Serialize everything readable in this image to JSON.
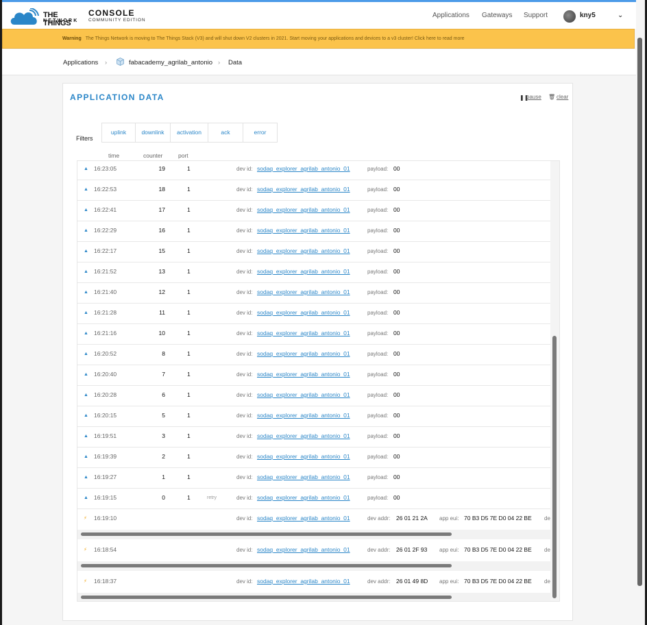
{
  "header": {
    "brand_line1": "THE THINGS",
    "brand_line2": "NETWORK",
    "console_title": "CONSOLE",
    "console_subtitle": "COMMUNITY EDITION",
    "nav": [
      "Applications",
      "Gateways",
      "Support"
    ],
    "username": "kny5"
  },
  "warning": {
    "label": "Warning",
    "text": "The Things Network is moving to The Things Stack (V3) and will shut down V2 clusters in 2021. Start moving your applications and devices to a v3 cluster! Click here to read more"
  },
  "breadcrumb": {
    "root": "Applications",
    "app": "fabacademy_agrilab_antonio",
    "current": "Data"
  },
  "card": {
    "title": "APPLICATION DATA",
    "pause_label": "pause",
    "clear_label": "clear",
    "filters_label": "Filters",
    "filters": [
      "uplink",
      "downlink",
      "activation",
      "ack",
      "error"
    ],
    "columns": {
      "time": "time",
      "counter": "counter",
      "port": "port"
    }
  },
  "labels": {
    "dev_id": "dev id:",
    "payload": "payload:",
    "dev_addr": "dev addr:",
    "app_eui": "app eui:",
    "retry": "retry",
    "truncated": "de"
  },
  "uplinks": [
    {
      "time": "16:23:05",
      "counter": "19",
      "port": "1",
      "dev_id": "sodaq_explorer_agrilab_antonio_01",
      "payload": "00"
    },
    {
      "time": "16:22:53",
      "counter": "18",
      "port": "1",
      "dev_id": "sodaq_explorer_agrilab_antonio_01",
      "payload": "00"
    },
    {
      "time": "16:22:41",
      "counter": "17",
      "port": "1",
      "dev_id": "sodaq_explorer_agrilab_antonio_01",
      "payload": "00"
    },
    {
      "time": "16:22:29",
      "counter": "16",
      "port": "1",
      "dev_id": "sodaq_explorer_agrilab_antonio_01",
      "payload": "00"
    },
    {
      "time": "16:22:17",
      "counter": "15",
      "port": "1",
      "dev_id": "sodaq_explorer_agrilab_antonio_01",
      "payload": "00"
    },
    {
      "time": "16:21:52",
      "counter": "13",
      "port": "1",
      "dev_id": "sodaq_explorer_agrilab_antonio_01",
      "payload": "00"
    },
    {
      "time": "16:21:40",
      "counter": "12",
      "port": "1",
      "dev_id": "sodaq_explorer_agrilab_antonio_01",
      "payload": "00"
    },
    {
      "time": "16:21:28",
      "counter": "11",
      "port": "1",
      "dev_id": "sodaq_explorer_agrilab_antonio_01",
      "payload": "00"
    },
    {
      "time": "16:21:16",
      "counter": "10",
      "port": "1",
      "dev_id": "sodaq_explorer_agrilab_antonio_01",
      "payload": "00"
    },
    {
      "time": "16:20:52",
      "counter": "8",
      "port": "1",
      "dev_id": "sodaq_explorer_agrilab_antonio_01",
      "payload": "00"
    },
    {
      "time": "16:20:40",
      "counter": "7",
      "port": "1",
      "dev_id": "sodaq_explorer_agrilab_antonio_01",
      "payload": "00"
    },
    {
      "time": "16:20:28",
      "counter": "6",
      "port": "1",
      "dev_id": "sodaq_explorer_agrilab_antonio_01",
      "payload": "00"
    },
    {
      "time": "16:20:15",
      "counter": "5",
      "port": "1",
      "dev_id": "sodaq_explorer_agrilab_antonio_01",
      "payload": "00"
    },
    {
      "time": "16:19:51",
      "counter": "3",
      "port": "1",
      "dev_id": "sodaq_explorer_agrilab_antonio_01",
      "payload": "00"
    },
    {
      "time": "16:19:39",
      "counter": "2",
      "port": "1",
      "dev_id": "sodaq_explorer_agrilab_antonio_01",
      "payload": "00"
    },
    {
      "time": "16:19:27",
      "counter": "1",
      "port": "1",
      "dev_id": "sodaq_explorer_agrilab_antonio_01",
      "payload": "00"
    },
    {
      "time": "16:19:15",
      "counter": "0",
      "port": "1",
      "dev_id": "sodaq_explorer_agrilab_antonio_01",
      "payload": "00",
      "retry": true
    }
  ],
  "activations": [
    {
      "time": "16:19:10",
      "dev_id": "sodaq_explorer_agrilab_antonio_01",
      "dev_addr": "26 01 21 2A",
      "app_eui": "70 B3 D5 7E D0 04 22 BE"
    },
    {
      "time": "16:18:54",
      "dev_id": "sodaq_explorer_agrilab_antonio_01",
      "dev_addr": "26 01 2F 93",
      "app_eui": "70 B3 D5 7E D0 04 22 BE"
    },
    {
      "time": "16:18:37",
      "dev_id": "sodaq_explorer_agrilab_antonio_01",
      "dev_addr": "26 01 49 8D",
      "app_eui": "70 B3 D5 7E D0 04 22 BE"
    }
  ],
  "colors": {
    "accent": "#2a86c8",
    "warning_bg": "#fbc34b",
    "activation_bolt": "#f2a81d"
  }
}
